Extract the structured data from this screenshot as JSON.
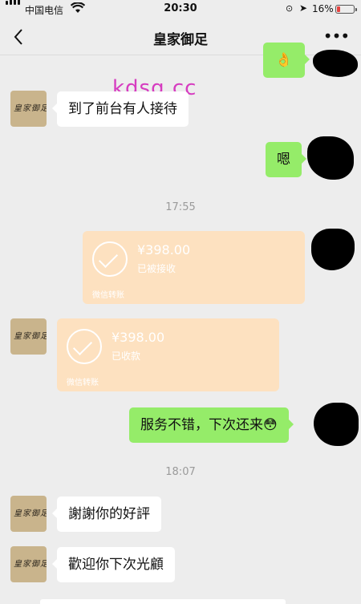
{
  "status_bar": {
    "carrier": "中国电信",
    "time": "20:30",
    "battery": "16%",
    "icons": [
      "signal-icon",
      "wifi-icon",
      "rotation-lock-icon",
      "location-icon",
      "battery-icon"
    ]
  },
  "nav": {
    "title": "皇家御足",
    "back_icon": "chevron-left-icon",
    "more_label": "•••"
  },
  "watermark": "kdsq.cc",
  "avatar_text": "皇家御足",
  "messages": [
    {
      "from": "other",
      "text": "到了前台有人接待"
    },
    {
      "from": "me",
      "text": "嗯"
    }
  ],
  "timestamps": [
    "17:55",
    "18:07"
  ],
  "transfers": [
    {
      "from": "me",
      "amount": "¥398.00",
      "status": "已被接收",
      "footer": "微信转账"
    },
    {
      "from": "other",
      "amount": "¥398.00",
      "status": "已收款",
      "footer": "微信转账"
    }
  ],
  "later_messages": [
    {
      "from": "me",
      "text": "服务不错，下次还来😳"
    },
    {
      "from": "other",
      "text": "謝謝你的好評"
    },
    {
      "from": "other",
      "text": "歡迎你下次光顧"
    }
  ],
  "colors": {
    "background": "#ededed",
    "sent_bubble": "#95ec69",
    "received_bubble": "#ffffff",
    "transfer_card": "#fde1c0",
    "watermark": "#d63cc0"
  }
}
